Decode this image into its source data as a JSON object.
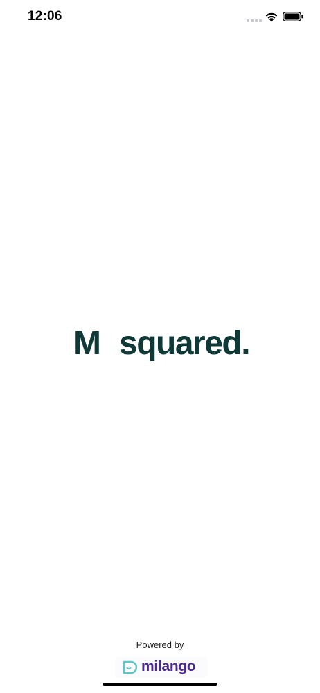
{
  "status_bar": {
    "time": "12:06",
    "signal_icon": "cellular-signal-icon",
    "wifi_icon": "wifi-icon",
    "battery_icon": "battery-icon"
  },
  "logo": {
    "letter": "M",
    "word": "squared.",
    "color": "#0f3936"
  },
  "footer": {
    "powered_by": "Powered by",
    "brand_name": "milango",
    "brand_icon": "milango-logo-icon",
    "brand_color": "#4b2b8f",
    "brand_icon_color": "#5ec8c8"
  }
}
